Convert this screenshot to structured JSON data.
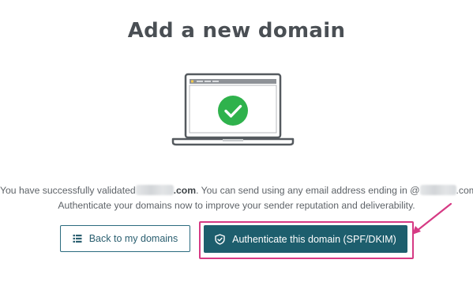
{
  "header": {
    "title": "Add a new domain"
  },
  "illustration": {
    "icon": "laptop-check-icon",
    "check_color": "#2fb24c",
    "frame_color": "#555a5f"
  },
  "message": {
    "line1_prefix": "You have successfully validated",
    "line1_domain_suffix": ".com",
    "line1_middle": ". You can send using any email address ending in @",
    "line1_end_suffix": ".com.",
    "line2": "Authenticate your domains now to improve your sender reputation and deliverability."
  },
  "actions": {
    "back_label": "Back to my domains",
    "back_icon": "list-icon",
    "authenticate_label": "Authenticate this domain (SPF/DKIM)",
    "authenticate_icon": "shield-check-icon"
  },
  "annotation": {
    "highlight_color": "#d63a84"
  },
  "colors": {
    "primary_button": "#1d5e6d",
    "secondary_border": "#2b6b7f"
  }
}
